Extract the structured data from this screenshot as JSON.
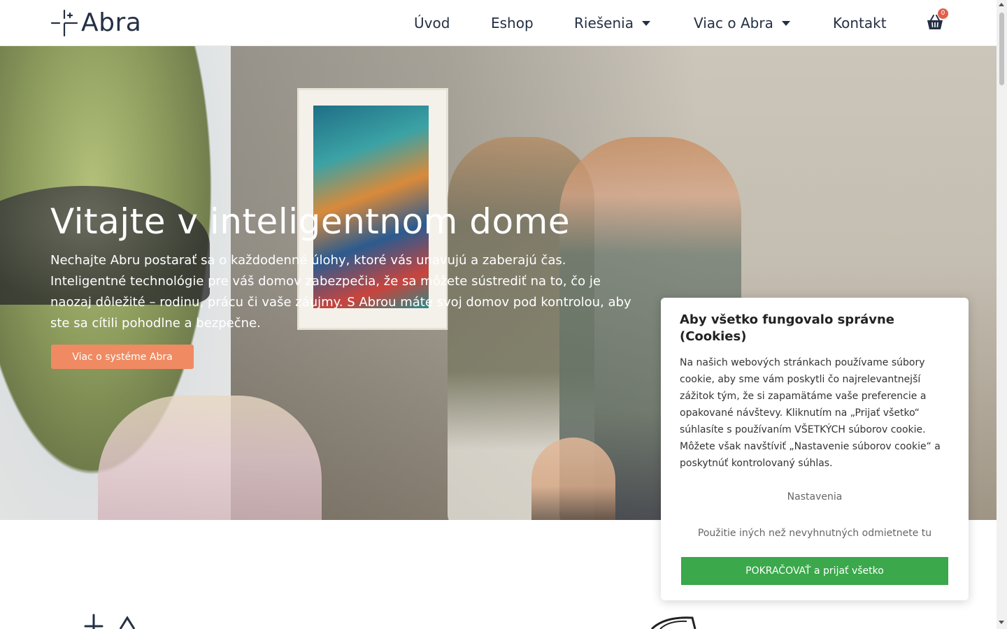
{
  "header": {
    "logo_text": "Abra",
    "nav": {
      "uvod": "Úvod",
      "eshop": "Eshop",
      "riesenia": "Riešenia",
      "viac": "Viac o Abra",
      "kontakt": "Kontakt"
    },
    "cart_count": "0"
  },
  "hero": {
    "title": "Vitajte v inteligentnom dome",
    "text": "Nechajte Abru postarať sa o každodenné úlohy, ktoré vás unavujú a zaberajú čas. Inteligentné technológie pre váš domov zabezpečia, že sa môžete sústrediť na to, čo je naozaj dôležité – rodinu, prácu či vaše záujmy. S Abrou máte svoj domov pod kontrolou, aby ste sa cítili pohodlne a bezpečne.",
    "button": "Viac o systéme Abra"
  },
  "cookie": {
    "title": "Aby všetko fungovalo správne (Cookies)",
    "text": "Na našich webových stránkach používame súbory cookie, aby sme vám poskytli čo najrelevantnejší zážitok tým, že si zapamätáme vaše preferencie a opakované návštevy. Kliknutím na „Prijať všetko“ súhlasíte s používaním VŠETKÝCH súborov cookie. Môžete však navštíviť „Nastavenie súborov cookie“ a poskytnúť kontrolovaný súhlas.",
    "settings": "Nastavenia",
    "reject": "Použitie iných než nevyhnutných odmietnete tu",
    "accept": "POKRAČOVAŤ a prijať všetko"
  },
  "colors": {
    "accent_button": "#ef8a62",
    "accept_button": "#3aa84b",
    "badge": "#e0614b",
    "text_dark": "#243044"
  },
  "icons": {
    "logo": "abra-cross-logo-icon",
    "cart": "shopping-basket-icon",
    "dropdown": "caret-down-icon"
  }
}
